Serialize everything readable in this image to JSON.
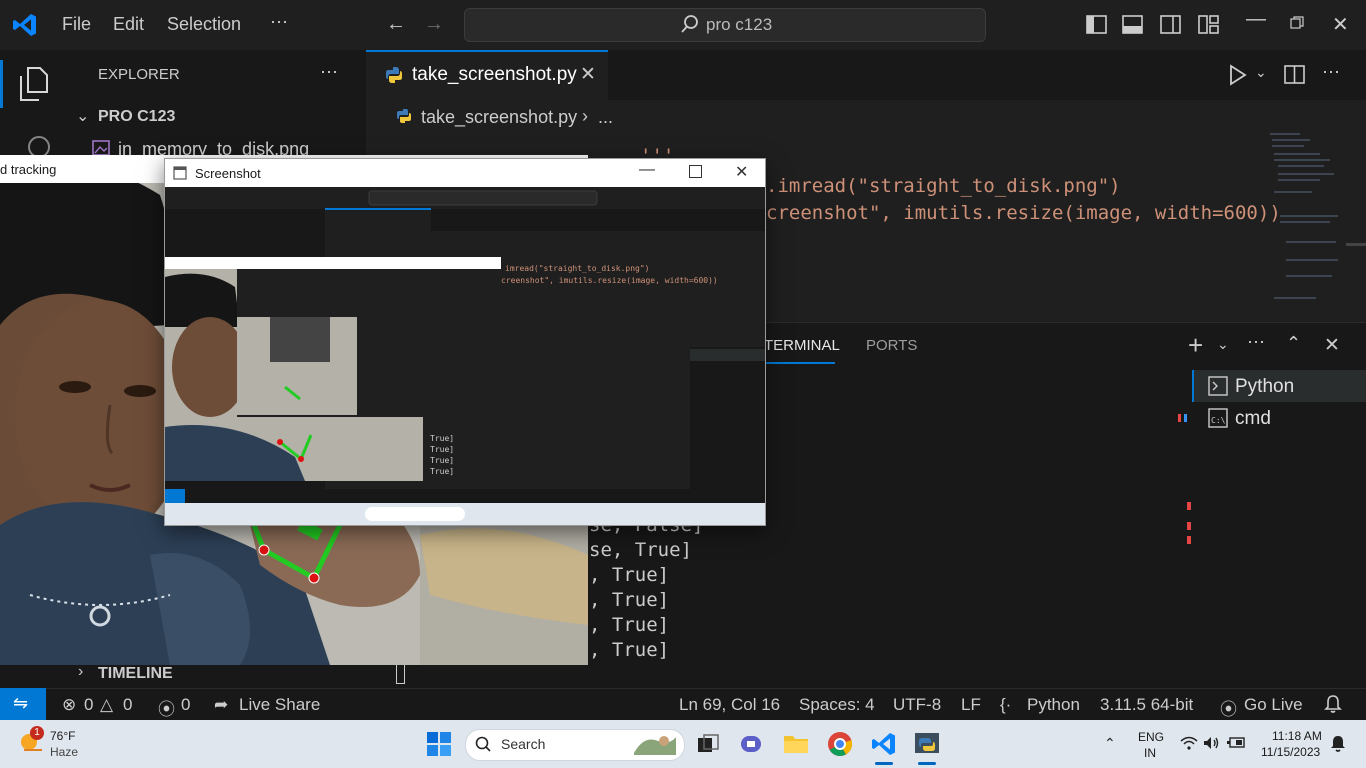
{
  "titlebar": {
    "menu": [
      "File",
      "Edit",
      "Selection",
      "⋯"
    ],
    "search": "pro c123"
  },
  "sidebar": {
    "title": "EXPLORER",
    "more": "⋯",
    "folder": "PRO C123",
    "file": "in_memory_to_disk.png",
    "timeline": "TIMELINE"
  },
  "editor": {
    "tab_label": "take_screenshot.py",
    "breadcrumb_file": "take_screenshot.py",
    "breadcrumb_more": "...",
    "lines": [
      "'''",
      ".imread(\"straight_to_disk.png\")",
      "creenshot\", imutils.resize(image, width=600))"
    ]
  },
  "panel": {
    "tab_terminal": "TERMINAL",
    "tab_ports": "PORTS",
    "terminals": [
      "Python",
      "cmd"
    ],
    "output": [
      "se, False]",
      "se, True]",
      ", True]",
      ", True]",
      ", True]",
      ", True]"
    ]
  },
  "statusbar": {
    "errors": "0",
    "warnings": "0",
    "ports": "0",
    "live_share": "Live Share",
    "position": "Ln 69, Col 16",
    "spaces": "Spaces: 4",
    "encoding": "UTF-8",
    "eol": "LF",
    "language": "Python",
    "interpreter": "3.11.5 64-bit",
    "go_live": "Go Live"
  },
  "webcam": {
    "title": "d tracking"
  },
  "screenshot_window": {
    "title": "Screenshot"
  },
  "taskbar": {
    "weather_temp": "76°F",
    "weather_desc": "Haze",
    "weather_badge": "1",
    "search_placeholder": "Search",
    "lang_top": "ENG",
    "lang_bottom": "IN",
    "time": "11:18 AM",
    "date": "11/15/2023"
  },
  "colors": {
    "accent": "#0078d4",
    "editor_bg": "#1f1f1f",
    "sidebar_bg": "#181818",
    "string": "#ce9178",
    "hand_skeleton": "#22cc22",
    "hand_joint": "#dd1111"
  }
}
